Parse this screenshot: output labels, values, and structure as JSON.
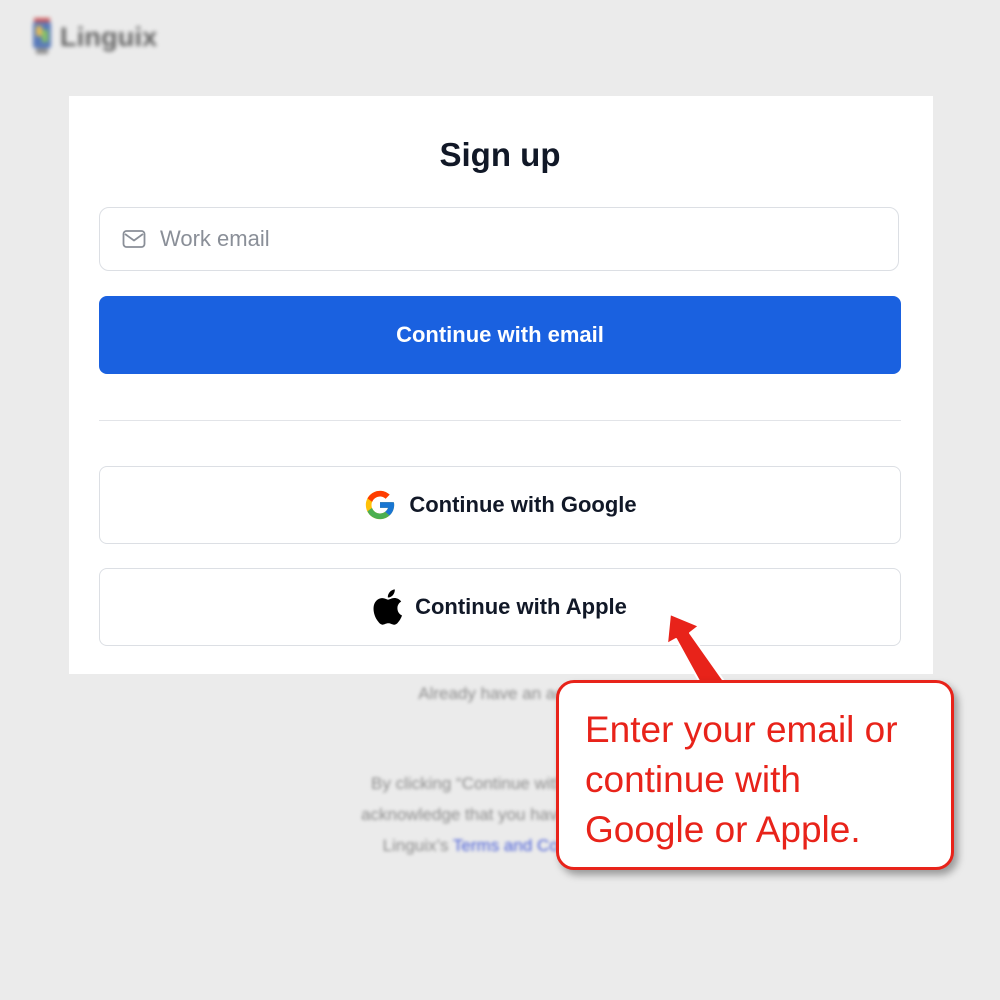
{
  "brand": {
    "name": "Linguix"
  },
  "form": {
    "title": "Sign up",
    "email_placeholder": "Work email",
    "email_value": "",
    "continue_email_label": "Continue with email",
    "google_label": "Continue with Google",
    "apple_label": "Continue with Apple"
  },
  "footer": {
    "already_text": "Already have an acco",
    "legal_line1": "By clicking “Continue with Google/",
    "legal_line2": "acknowledge that you have read and",
    "legal_line3_prefix": "Linguix’s",
    "legal_line3_link": "Terms and Conditions"
  },
  "annotation": {
    "lines": [
      "Enter your email or",
      "continue with",
      "Google or Apple."
    ]
  },
  "colors": {
    "primary_button": "#1a61e0",
    "callout": "#e8231a",
    "background": "#ebebeb"
  },
  "icons": {
    "email": "mail-icon",
    "google": "google-icon",
    "apple": "apple-icon",
    "logo": "linguix-logo-icon"
  }
}
